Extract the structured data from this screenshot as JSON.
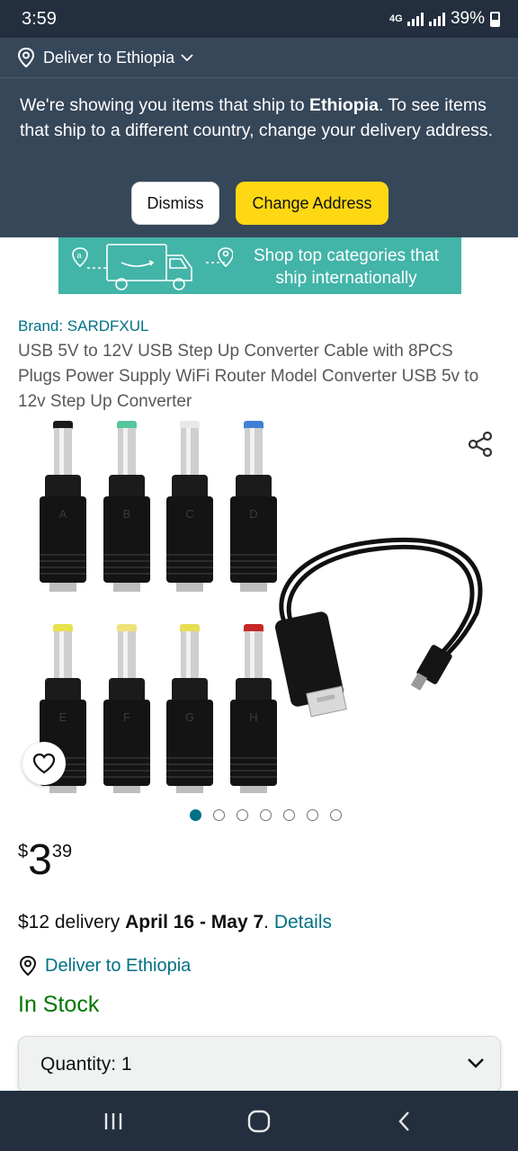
{
  "status": {
    "time": "3:59",
    "network": "4G",
    "battery": "39%"
  },
  "deliver_strip": {
    "label": "Deliver to Ethiopia"
  },
  "banner": {
    "text_before": "We're showing you items that ship to ",
    "country": "Ethiopia",
    "text_after": ". To see items that ship to a different country, change your delivery address.",
    "dismiss_label": "Dismiss",
    "change_label": "Change Address"
  },
  "promo": {
    "text": "Shop top categories that ship internationally"
  },
  "product": {
    "brand": "Brand: SARDFXUL",
    "title": "USB 5V to 12V USB Step Up Converter Cable with 8PCS Plugs Power Supply WiFi Router Model Converter USB 5v to 12v Step Up Converter",
    "plug_letters": [
      "A",
      "B",
      "C",
      "D",
      "E",
      "F",
      "G",
      "H"
    ],
    "tip_colors": [
      "#1a1a1a",
      "#55c79a",
      "#e8e8e8",
      "#3f7fd6",
      "#e6e24a",
      "#eee27a",
      "#e6dd52",
      "#c62828"
    ],
    "image_count": 7,
    "active_image": 1
  },
  "price": {
    "symbol": "$",
    "whole": "3",
    "fraction": "39"
  },
  "delivery": {
    "cost": "$12 delivery ",
    "dates": "April 16 - May 7",
    "period": ". ",
    "details_link": "Details"
  },
  "deliver_to": "Deliver to Ethiopia",
  "stock": "In Stock",
  "quantity": {
    "label": "Quantity: 1"
  },
  "colors": {
    "header_dark": "#232f3e",
    "header_mid": "#37475a",
    "link": "#007185",
    "stock": "#007600",
    "button_yellow": "#ffd814",
    "promo_teal": "#43b4a8"
  }
}
